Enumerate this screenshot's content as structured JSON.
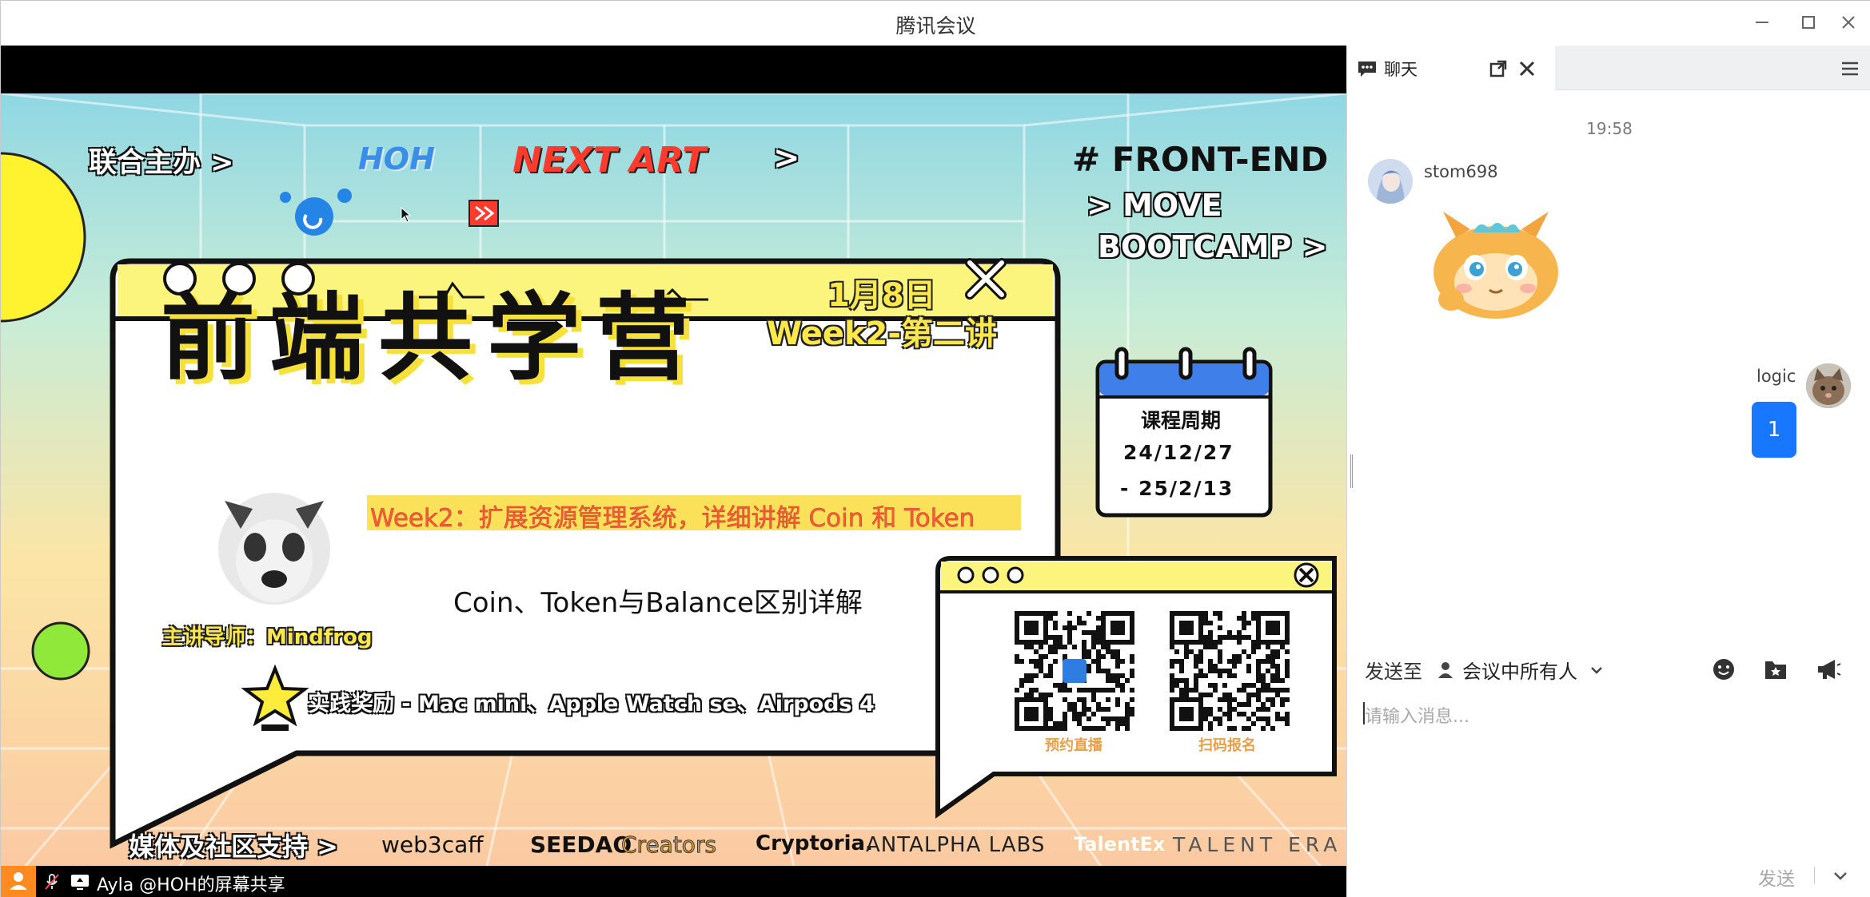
{
  "window": {
    "title": "腾讯会议"
  },
  "share": {
    "presenter_label": "Ayla @HOH的屏幕共享",
    "slide": {
      "organizers_label": "联合主办 >",
      "org_hoh": "HOH",
      "org_nextart": "NEXT ART",
      "arrow": ">",
      "hashtag": "# FRONT-END",
      "move_line1": "> MOVE",
      "move_line2": "BOOTCAMP >",
      "main_title": "前端共学营",
      "date": "1月8日",
      "week": "Week2-第二讲",
      "subtitle": "Week2：扩展资源管理系统，详细讲解 Coin 和 Token",
      "topic": "Coin、Token与Balance区别详解",
      "mentor": "主讲导师：Mindfrog",
      "reward": "实践奖励 - Mac mini、Apple Watch se、Airpods 4",
      "calendar_title": "课程周期",
      "calendar_line1": "24/12/27",
      "calendar_line2": "- 25/2/13",
      "qr1_label": "预约直播",
      "qr2_label": "扫码报名",
      "media_label": "媒体及社区支持 >",
      "sponsors": [
        "web3caff",
        "SEEDAO",
        "Creators",
        "Cryptoria.",
        "ANTALPHA LABS",
        "TalentEx",
        "TALENT ERA"
      ]
    }
  },
  "chat": {
    "tab_label": "聊天",
    "timestamp": "19:58",
    "messages": [
      {
        "user": "stom698",
        "type": "sticker",
        "side": "left"
      },
      {
        "user": "logic",
        "type": "text",
        "text": "1",
        "side": "right"
      }
    ],
    "send_to_label": "发送至",
    "send_target": "会议中所有人",
    "input_placeholder": "请输入消息...",
    "send_button": "发送"
  },
  "colors": {
    "accent": "#1777ff",
    "chat_bg": "#ffffff",
    "tabbar_bg": "#eef0f2"
  }
}
